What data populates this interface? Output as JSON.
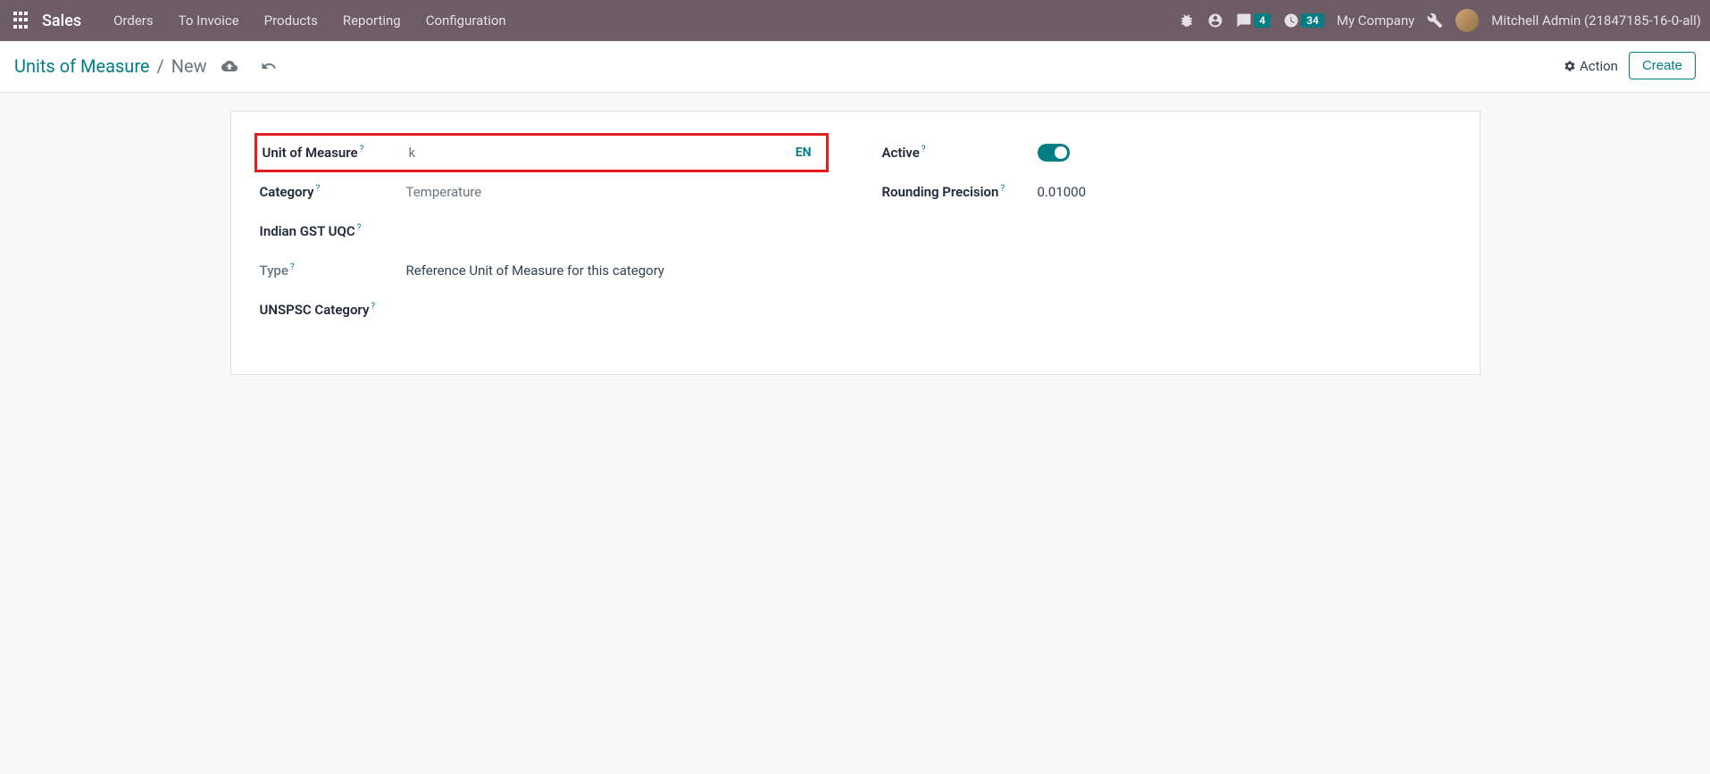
{
  "navbar": {
    "brand": "Sales",
    "menu": [
      "Orders",
      "To Invoice",
      "Products",
      "Reporting",
      "Configuration"
    ],
    "messages_count": "4",
    "activities_count": "34",
    "company": "My Company",
    "user": "Mitchell Admin (21847185-16-0-all)"
  },
  "breadcrumb": {
    "parent": "Units of Measure",
    "current": "New"
  },
  "buttons": {
    "action": "Action",
    "create": "Create"
  },
  "form": {
    "left": {
      "uom_label": "Unit of Measure",
      "uom_value": "k",
      "lang": "EN",
      "category_label": "Category",
      "category_value": "Temperature",
      "gst_label": "Indian GST UQC",
      "gst_value": "",
      "type_label": "Type",
      "type_value": "Reference Unit of Measure for this category",
      "unspsc_label": "UNSPSC Category",
      "unspsc_value": ""
    },
    "right": {
      "active_label": "Active",
      "active_value": true,
      "rounding_label": "Rounding Precision",
      "rounding_value": "0.01000"
    }
  }
}
